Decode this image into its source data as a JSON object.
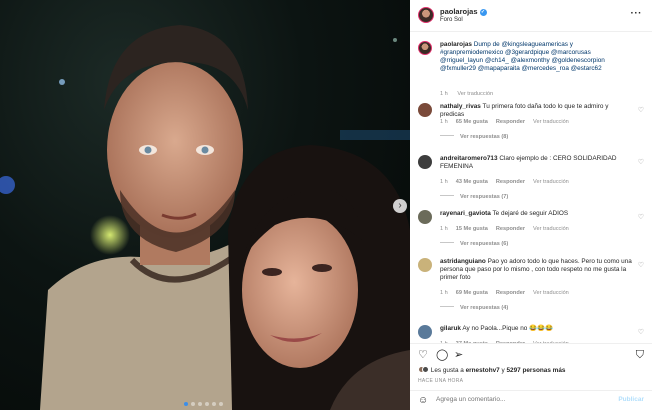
{
  "post": {
    "username": "paolarojas",
    "location": "Foro Sol",
    "more_icon": "more-horizontal-icon"
  },
  "caption": {
    "username": "paolarojas",
    "text": "Dump de @kingsleagueamericas y #granpremiodemexico @3gerardpique @marcorusas @rriguel_layun @ch14_ @alexmonthy @goldenescorpion @fxmuller29 @mapaparaita @mercedes_roa @estarc62",
    "time": "1 h",
    "translate": "Ver traducción"
  },
  "comments": [
    {
      "username": "nathaly_rivas",
      "text": "Tu primera foto daña todo lo que te admiro y predicas",
      "time": "1 h",
      "likes": "65 Me gusta",
      "reply": "Responder",
      "translate": "Ver traducción",
      "replies": "Ver respuestas (8)",
      "color": "#7a4a3a"
    },
    {
      "username": "andreitaromero713",
      "text": "Claro ejemplo de : CERO SOLIDARIDAD FEMENINA",
      "time": "1 h",
      "likes": "43 Me gusta",
      "reply": "Responder",
      "translate": "Ver traducción",
      "replies": "Ver respuestas (7)",
      "color": "#3d3d3d"
    },
    {
      "username": "rayenari_gaviota",
      "text": "Te dejaré de seguir ADIOS",
      "time": "1 h",
      "likes": "15 Me gusta",
      "reply": "Responder",
      "translate": "Ver traducción",
      "replies": "Ver respuestas (6)",
      "color": "#6b6b5a"
    },
    {
      "username": "astridanguiano",
      "text": "Pao yo adoro todo lo que haces. Pero tu como una persona que paso por lo mismo , con todo respeto no me gusta la primer foto",
      "time": "1 h",
      "likes": "69 Me gusta",
      "reply": "Responder",
      "translate": "Ver traducción",
      "replies": "Ver respuestas (4)",
      "color": "#c9b27a"
    },
    {
      "username": "gilaruk",
      "text": "Ay no Paola...Pique no 😂😂😂",
      "time": "1 h",
      "likes": "37 Me gusta",
      "reply": "Responder",
      "translate": "Ver traducción",
      "replies": "",
      "color": "#5a7a9a"
    }
  ],
  "likes_line": {
    "prefix": "Les gusta a",
    "user": "ernestohv7",
    "conj": "y",
    "others": "5297 personas más"
  },
  "ago": "HACE UNA HORA",
  "add_comment": {
    "placeholder": "Agrega un comentario...",
    "publish": "Publicar"
  },
  "colors": {
    "link": "#00376b",
    "muted": "#8e8e8e",
    "verified": "#3897f0",
    "publish_disabled": "#b2dffc"
  }
}
